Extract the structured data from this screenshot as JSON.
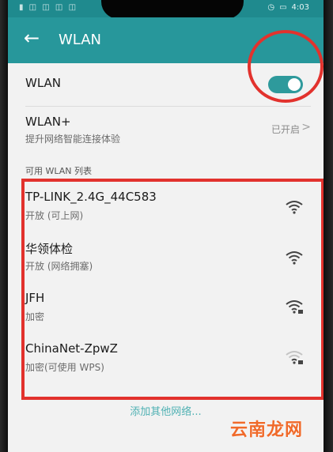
{
  "status_bar": {
    "time": "4:03"
  },
  "app_bar": {
    "title": "WLAN"
  },
  "wlan": {
    "label": "WLAN",
    "enabled": true
  },
  "wlan_plus": {
    "title": "WLAN+",
    "subtitle": "提升网络智能连接体验",
    "status": "已开启"
  },
  "section_label": "可用 WLAN 列表",
  "networks": [
    {
      "name": "TP-LINK_2.4G_44C583",
      "status": "开放 (可上网)",
      "secured": false,
      "signal": "strong"
    },
    {
      "name": "华领体检",
      "status": "开放 (网络拥塞)",
      "secured": false,
      "signal": "strong"
    },
    {
      "name": "JFH",
      "status": "加密",
      "secured": true,
      "signal": "strong"
    },
    {
      "name": "ChinaNet-ZpwZ",
      "status": "加密(可使用 WPS)",
      "secured": true,
      "signal": "weak"
    }
  ],
  "add_network": "添加其他网络...",
  "watermark": "云南龙网",
  "colors": {
    "accent": "#27979b",
    "highlight": "#e2322d"
  }
}
